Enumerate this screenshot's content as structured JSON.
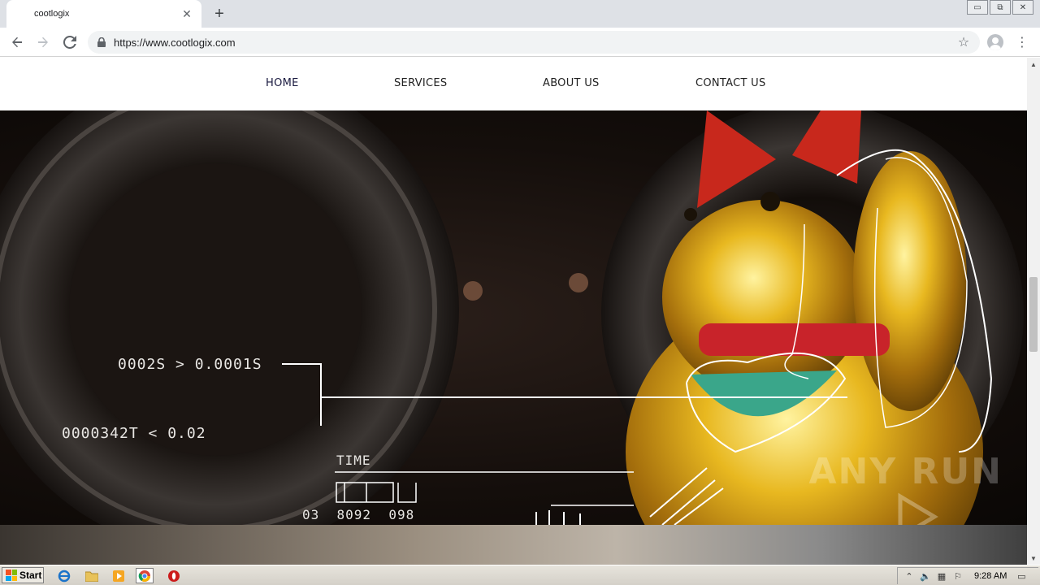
{
  "browser": {
    "tab_title": "cootlogix",
    "tab_close": "✕",
    "new_tab": "+",
    "url": "https://www.cootlogix.com",
    "window_controls": [
      "▭",
      "⧉",
      "✕"
    ]
  },
  "site": {
    "nav": [
      "HOME",
      "SERVICES",
      "ABOUT US",
      "CONTACT US"
    ]
  },
  "hero": {
    "readout_1": "0002S > 0.0001S",
    "readout_2": "0000342T < 0.02",
    "time_label": "TIME",
    "digits": "03  8092  098",
    "watermark": "ANY  RUN"
  },
  "taskbar": {
    "start": "Start",
    "clock": "9:28 AM"
  },
  "icons": [
    "back-icon",
    "forward-icon",
    "reload-icon",
    "lock-icon",
    "star-icon",
    "account-icon",
    "menu-icon"
  ],
  "colors": {
    "chrome_bg": "#dee1e6",
    "hero_bg": "#140e0b",
    "gold": "#e0b020"
  }
}
